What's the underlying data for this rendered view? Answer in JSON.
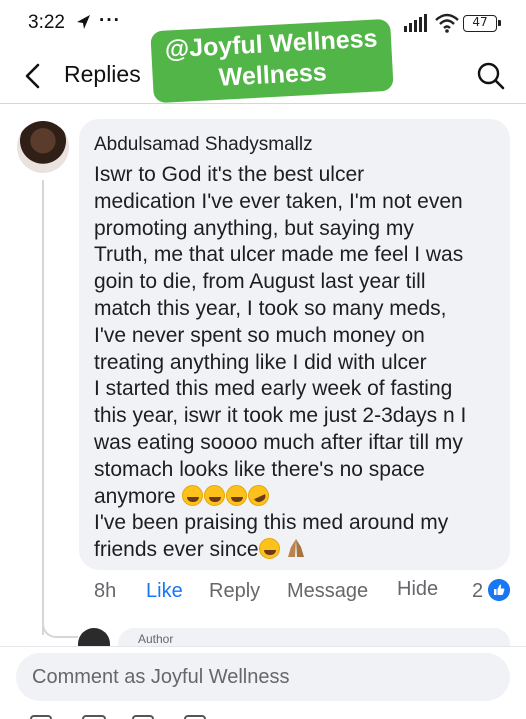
{
  "status_bar": {
    "time": "3:22",
    "dots": "···",
    "battery": "47"
  },
  "header": {
    "title": "Replies"
  },
  "watermark": {
    "line1": "@Joyful Wellness",
    "line2": "Wellness"
  },
  "comment": {
    "author": "Abdulsamad Shadysmallz",
    "lines": [
      "Iswr to God it's the best ulcer",
      "medication I've ever taken, I'm not even",
      "promoting anything, but saying my",
      "Truth, me that ulcer made me feel I was",
      "goin to die, from August last year till",
      "match this year, I took so many meds,",
      "I've never spent so much money on",
      "treating anything like I did with ulcer",
      "I started this med early week of fasting",
      "this year, iswr it took me just 2-3days n I",
      "was eating soooo much after iftar till my",
      "stomach looks like there's no space",
      "anymore",
      "I've been praising this med around my",
      "friends ever since"
    ],
    "emoji": [
      "face-with-tears-of-joy",
      "face-with-tears-of-joy",
      "face-with-tears-of-joy",
      "rolling-on-floor-laughing",
      "grinning-face-with-sweat",
      "folded-hands"
    ]
  },
  "actions": {
    "time": "8h",
    "like": "Like",
    "reply": "Reply",
    "message": "Message",
    "hide": "Hide",
    "reaction_count": "2"
  },
  "next_reply": {
    "author_tag": "Author"
  },
  "composer": {
    "placeholder": "Comment as Joyful Wellness"
  },
  "colors": {
    "accent": "#1877f2",
    "watermark": "#52b548",
    "bubble": "#f0f2f5"
  }
}
